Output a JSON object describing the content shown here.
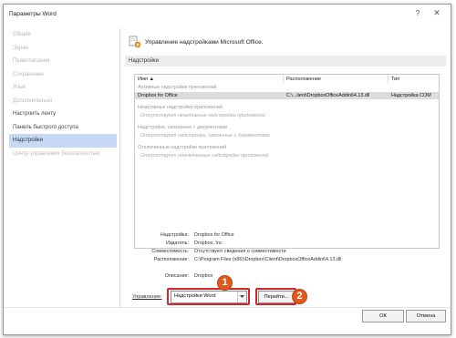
{
  "window": {
    "title": "Параметры Word",
    "help": "?",
    "close": "✕"
  },
  "sidebar": {
    "items": [
      {
        "label": "Общие",
        "state": "disabled"
      },
      {
        "label": "Экран",
        "state": "disabled"
      },
      {
        "label": "Правописание",
        "state": "disabled"
      },
      {
        "label": "Сохранение",
        "state": "disabled"
      },
      {
        "label": "Язык",
        "state": "disabled"
      },
      {
        "label": "Дополнительно",
        "state": "disabled"
      },
      {
        "label": "Настроить ленту",
        "state": "enabled"
      },
      {
        "label": "Панель быстрого доступа",
        "state": "enabled"
      },
      {
        "label": "Надстройки",
        "state": "active"
      },
      {
        "label": "Центр управления безопасностью",
        "state": "disabled"
      }
    ]
  },
  "main": {
    "header_text": "Управление надстройками Microsoft Office.",
    "section_title": "Надстройки",
    "table": {
      "col_name": "Имя ▲",
      "col_location": "Расположение",
      "col_type": "Тип",
      "groups": [
        {
          "title": "Активные надстройки приложений",
          "rows": [
            {
              "name": "Dropbox for Office",
              "location": "C:\\...lient\\DropboxOfficeAddin64.13.dll",
              "type": "Надстройка COM",
              "selected": true
            }
          ]
        },
        {
          "title": "Неактивные надстройки приложений",
          "empty": "Отсутствуют неактивные надстройки приложений"
        },
        {
          "title": "Надстройки, связанные с документами",
          "empty": "Отсутствуют надстройки, связанные с документами"
        },
        {
          "title": "Отключенные надстройки приложений",
          "empty": "Отсутствуют отключенные надстройки приложений"
        }
      ]
    },
    "details": {
      "addin_label": "Надстройка:",
      "addin_value": "Dropbox for Office",
      "publisher_label": "Издатель:",
      "publisher_value": "Dropbox, Inc",
      "compat_label": "Совместимость:",
      "compat_value": "Отсутствуют сведения о совместимости",
      "location_label": "Расположение:",
      "location_value": "C:\\Program Files (x86)\\Dropbox\\Client\\DropboxOfficeAddin64.13.dll",
      "desc_label": "Описание:",
      "desc_value": "Dropbox"
    },
    "manage": {
      "label": "Управление:",
      "selected": "Надстройки Word",
      "go_button": "Перейти..."
    },
    "annotations": {
      "badge1": "1",
      "badge2": "2",
      "color": "#d9222a"
    }
  },
  "footer": {
    "ok": "ОК",
    "cancel": "Отмена"
  }
}
